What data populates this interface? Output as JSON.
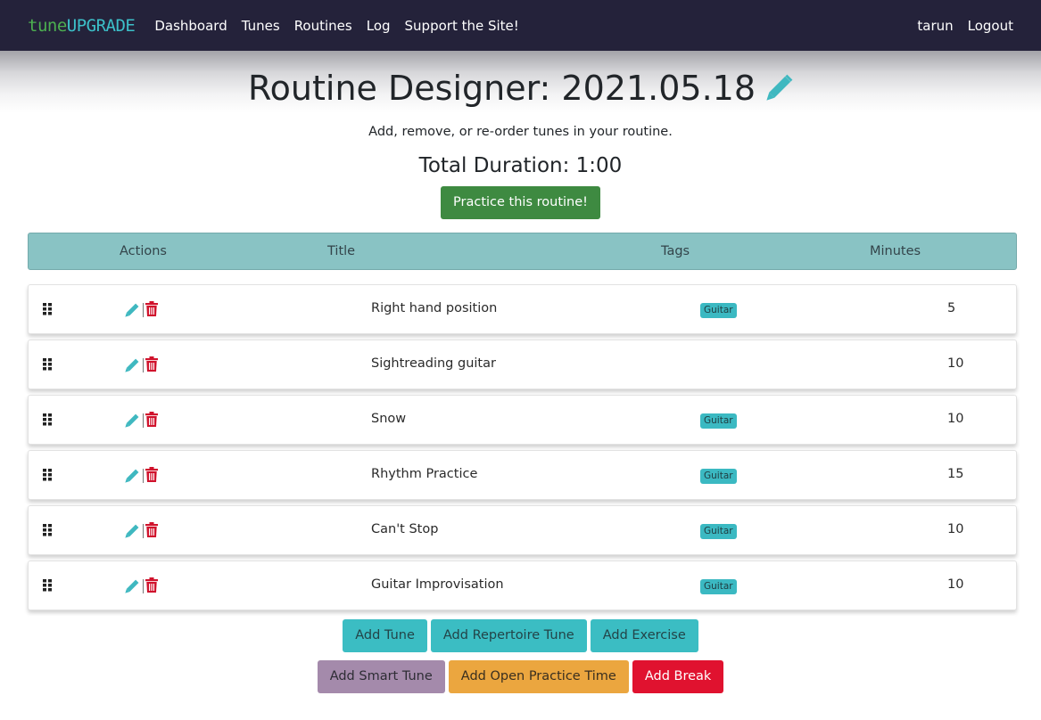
{
  "nav": {
    "logo_part1": "tune",
    "logo_part2": "UPGRADE",
    "links": [
      "Dashboard",
      "Tunes",
      "Routines",
      "Log",
      "Support the Site!"
    ],
    "user": "tarun",
    "logout": "Logout"
  },
  "page": {
    "title": "Routine Designer: 2021.05.18",
    "edit_icon": "pencil-icon",
    "subtitle": "Add, remove, or re-order tunes in your routine.",
    "total_duration": "Total Duration: 1:00",
    "practice_button": "Practice this routine!"
  },
  "table": {
    "headers": {
      "actions": "Actions",
      "title": "Title",
      "tags": "Tags",
      "minutes": "Minutes"
    },
    "rows": [
      {
        "title": "Right hand position",
        "tag": "Guitar",
        "minutes": "5"
      },
      {
        "title": "Sightreading guitar",
        "tag": "",
        "minutes": "10"
      },
      {
        "title": "Snow",
        "tag": "Guitar",
        "minutes": "10"
      },
      {
        "title": "Rhythm Practice",
        "tag": "Guitar",
        "minutes": "15"
      },
      {
        "title": "Can't Stop",
        "tag": "Guitar",
        "minutes": "10"
      },
      {
        "title": "Guitar Improvisation",
        "tag": "Guitar",
        "minutes": "10"
      }
    ],
    "row_icons": [
      "drag-handle-icon",
      "pencil-icon",
      "trash-icon"
    ]
  },
  "buttons": {
    "add_tune": "Add Tune",
    "add_repertoire_tune": "Add Repertoire Tune",
    "add_exercise": "Add Exercise",
    "add_smart_tune": "Add Smart Tune",
    "add_open_practice_time": "Add Open Practice Time",
    "add_break": "Add Break"
  },
  "colors": {
    "navbar": "#24223a",
    "logo_green": "#4caf50",
    "logo_teal": "#3cc0c9",
    "table_header": "#89c3c4",
    "practice_green": "#3e8a41",
    "teal_button": "#3bbdc3",
    "purple_button": "#a48aab",
    "orange_button": "#eba63f",
    "red_button": "#e0122f",
    "tag": "#3bb9c2",
    "pencil": "#3fb8c0",
    "trash": "#d0122c"
  }
}
